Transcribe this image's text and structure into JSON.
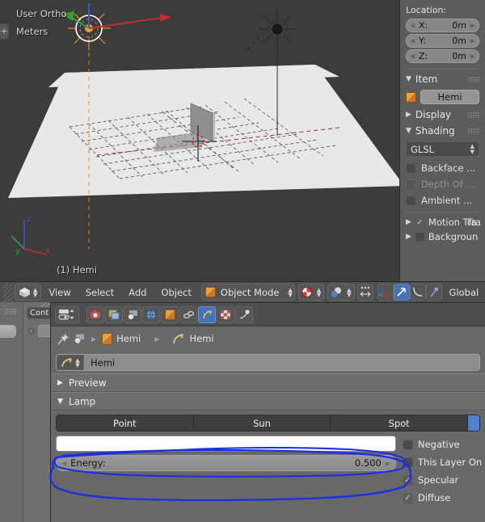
{
  "viewport": {
    "view_label": "User Ortho",
    "unit_label": "Meters",
    "object_label": "(1) Hemi",
    "axis_x": "x",
    "axis_y": "y",
    "axis_z": "z",
    "toggle_label": "+",
    "bg_color": "#3c3c3c",
    "floor_color": "#e6e6e6"
  },
  "npanel": {
    "location_label": "Location:",
    "location_fields": [
      {
        "name": "X:",
        "value": "0m"
      },
      {
        "name": "Y:",
        "value": "0m"
      },
      {
        "name": "Z:",
        "value": "0m"
      }
    ],
    "item_header": "Item",
    "item_name": "Hemi",
    "display_header": "Display",
    "shading_header": "Shading",
    "shading_mode": "GLSL",
    "shading_options": [
      {
        "label": "Backface ...",
        "checked": false,
        "disabled": false
      },
      {
        "label": "Depth Of ...",
        "checked": false,
        "disabled": true
      },
      {
        "label": "Ambient ...",
        "checked": false,
        "disabled": false
      }
    ],
    "motion_tracking": "Motion Tra",
    "motion_tracking_overlap": "Tra",
    "motion_tracking_checked": true,
    "background": "Backgroun",
    "background_checked": false
  },
  "header": {
    "editor_type_icon": "editor-type-3dview",
    "menus": [
      "View",
      "Select",
      "Add",
      "Object"
    ],
    "mode": "Object Mode",
    "shading_icon": "material-shading-icon",
    "snap_icon": "snap-magnet-icon",
    "manipulator_icons": [
      "translate-manipulator",
      "rotate-manipulator",
      "scale-manipulator"
    ],
    "transform_orientation": "Global"
  },
  "properties": {
    "tabs": [
      {
        "name": "render-tab",
        "icon": "camera-icon",
        "active": false
      },
      {
        "name": "render-layers-tab",
        "icon": "images-icon",
        "active": false
      },
      {
        "name": "scene-tab",
        "icon": "scene-icon",
        "active": false
      },
      {
        "name": "world-tab",
        "icon": "globe-icon",
        "active": false
      },
      {
        "name": "object-tab",
        "icon": "cube-icon",
        "active": false
      },
      {
        "name": "constraints-tab",
        "icon": "chain-icon",
        "active": false
      },
      {
        "name": "data-tab",
        "icon": "lamp-icon",
        "active": true
      },
      {
        "name": "texture-tab",
        "icon": "checker-icon",
        "active": false
      },
      {
        "name": "physics-tab",
        "icon": "physics-icon",
        "active": false
      }
    ],
    "breadcrumb": [
      {
        "icon": "pin-icon",
        "label": ""
      },
      {
        "icon": "scene-icon",
        "label": ""
      },
      {
        "icon": "cube-icon",
        "label": "Hemi"
      },
      {
        "icon": "lamp-icon",
        "label": "Hemi"
      }
    ],
    "datablock_name": "Hemi",
    "panels": [
      {
        "label": "Preview",
        "open": false
      },
      {
        "label": "Lamp",
        "open": true
      }
    ],
    "lamp_types": [
      {
        "label": "Point",
        "active": false
      },
      {
        "label": "Sun",
        "active": false
      },
      {
        "label": "Spot",
        "active": false
      },
      {
        "label": "",
        "active": true
      }
    ],
    "color_swatch": "#ffffff",
    "energy": {
      "label": "Energy:",
      "value": "0.500"
    },
    "toggles": [
      {
        "label": "Negative",
        "checked": false
      },
      {
        "label": "This Layer On",
        "checked": false
      },
      {
        "label": "Specular",
        "checked": true
      },
      {
        "label": "Diffuse",
        "checked": true
      }
    ]
  },
  "background_window": {
    "context_tab": "Cont"
  },
  "annotation": {
    "color": "#1a2ee6",
    "shapes": "two hand-drawn ellipses circling the lamp color swatch and the Energy slider"
  }
}
